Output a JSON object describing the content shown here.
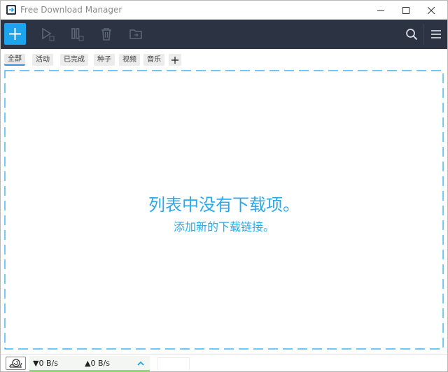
{
  "window": {
    "title": "Free Download Manager"
  },
  "toolbar": {
    "add_icon": "plus-icon",
    "start_icon": "play-icon",
    "pause_icon": "pause-icon",
    "delete_icon": "trash-icon",
    "move_icon": "folder-icon",
    "search_icon": "search-icon",
    "menu_icon": "hamburger-menu-icon"
  },
  "tabs": [
    {
      "label": "全部",
      "active": true
    },
    {
      "label": "活动",
      "active": false
    },
    {
      "label": "已完成",
      "active": false
    },
    {
      "label": "种子",
      "active": false
    },
    {
      "label": "视频",
      "active": false
    },
    {
      "label": "音乐",
      "active": false
    }
  ],
  "empty_state": {
    "title": "列表中没有下载项。",
    "subtitle": "添加新的下载链接。"
  },
  "statusbar": {
    "download_speed": "▼0 B/s",
    "upload_speed": "▲0 B/s",
    "snail_icon": "snail-icon",
    "expand_icon": "chevron-up-icon"
  },
  "colors": {
    "toolbar_bg": "#2c3444",
    "accent": "#1ca4ee",
    "empty_text": "#2ea8e8",
    "speed_bar": "#9bd37a"
  }
}
